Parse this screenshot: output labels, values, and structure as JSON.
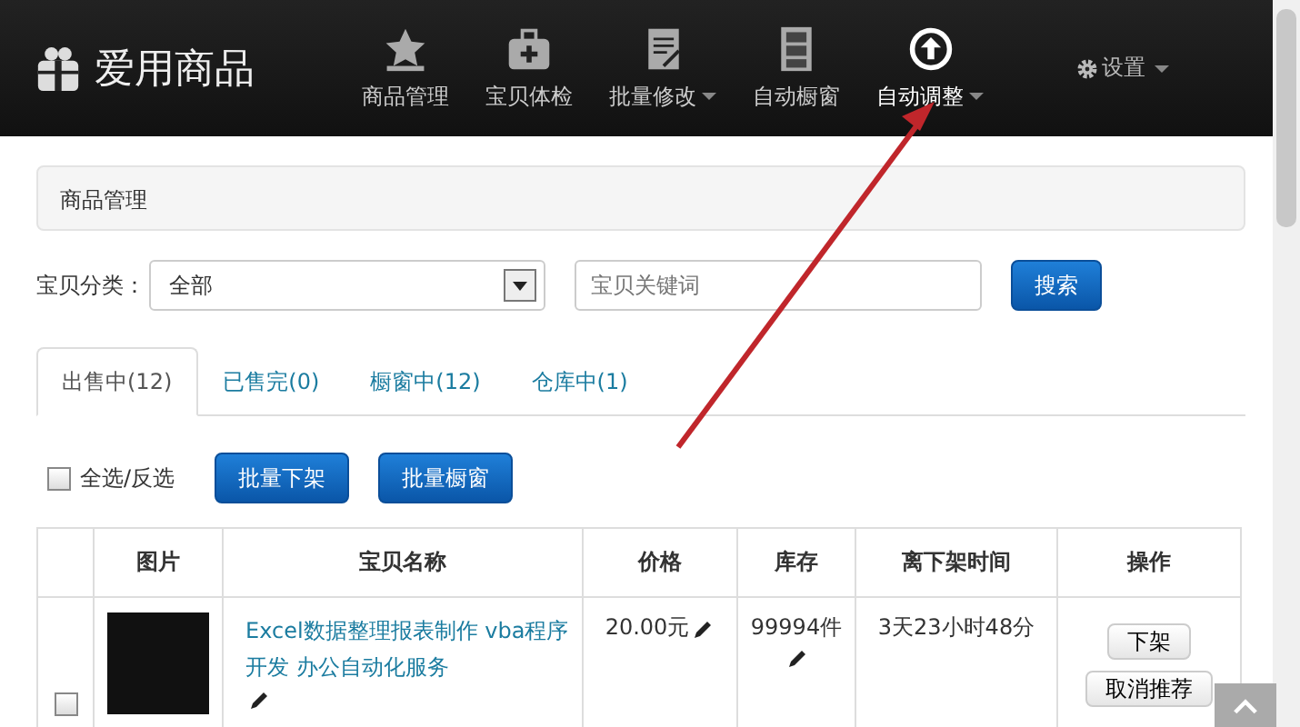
{
  "header": {
    "logo": "爱用商品",
    "nav": [
      {
        "label": "商品管理",
        "dropdown": false,
        "selected": false
      },
      {
        "label": "宝贝体检",
        "dropdown": false,
        "selected": false
      },
      {
        "label": "批量修改",
        "dropdown": true,
        "selected": false
      },
      {
        "label": "自动橱窗",
        "dropdown": false,
        "selected": false
      },
      {
        "label": "自动调整",
        "dropdown": true,
        "selected": true
      }
    ],
    "settings": "设置"
  },
  "breadcrumb": "商品管理",
  "filter": {
    "category_label": "宝贝分类：",
    "category_value": "全部",
    "keyword_placeholder": "宝贝关键词",
    "search_button": "搜索"
  },
  "tabs": [
    {
      "label": "出售中(12)",
      "selected": true
    },
    {
      "label": "已售完(0)",
      "selected": false
    },
    {
      "label": "橱窗中(12)",
      "selected": false
    },
    {
      "label": "仓库中(1)",
      "selected": false
    }
  ],
  "bulk": {
    "select_all": "全选/反选",
    "checked": false,
    "buttons": [
      "批量下架",
      "批量橱窗"
    ]
  },
  "table": {
    "columns": [
      "",
      "图片",
      "宝贝名称",
      "价格",
      "库存",
      "离下架时间",
      "操作"
    ],
    "rows": [
      {
        "checked": false,
        "name": "Excel数据整理报表制作 vba程序开发 办公自动化服务",
        "price": "20.00元",
        "stock": "99994件",
        "time_left": "3天23小时48分",
        "actions": [
          "下架",
          "取消推荐"
        ]
      }
    ]
  }
}
